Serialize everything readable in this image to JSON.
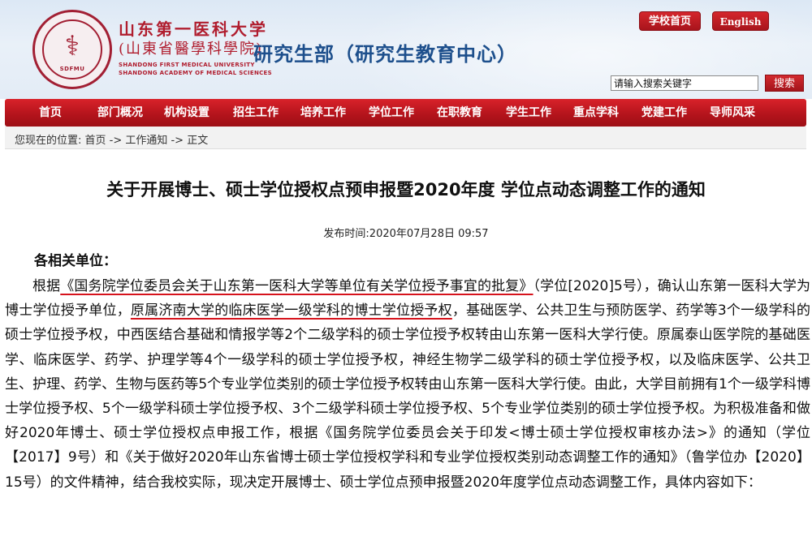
{
  "header": {
    "university_cn_line1": "山东第一医科大学",
    "university_cn_line2": "(山東省醫學科學院)",
    "university_en_line1": "SHANDONG FIRST MEDICAL UNIVERSITY",
    "university_en_line2": "SHANDONG ACADEMY OF MEDICAL SCIENCES",
    "logo_text": "SDFMU",
    "department": "研究生部（研究生教育中心）",
    "home_button": "学校首页",
    "english_button": "English",
    "search_placeholder": "请输入搜索关键字",
    "search_button": "搜索"
  },
  "nav": {
    "items": [
      {
        "label": "首页"
      },
      {
        "label": "部门概况"
      },
      {
        "label": "机构设置"
      },
      {
        "label": "招生工作"
      },
      {
        "label": "培养工作"
      },
      {
        "label": "学位工作"
      },
      {
        "label": "在职教育"
      },
      {
        "label": "学生工作"
      },
      {
        "label": "重点学科"
      },
      {
        "label": "党建工作"
      },
      {
        "label": "导师风采"
      }
    ]
  },
  "breadcrumb": {
    "text": "您现在的位置: 首页 -> 工作通知 -> 正文"
  },
  "article": {
    "title": "关于开展博士、硕士学位授权点预申报暨2020年度 学位点动态调整工作的通知",
    "publish_time": "发布时间:2020年07月28日 09:57",
    "greeting": "各相关单位：",
    "p_lead": "根据",
    "p_link1": "《国务院学位委员会关于山东第一医科大学等单位有关学位授予事宜的批复》",
    "p_mid1": "（学位[2020]5号），确认山东第一医科大学为博士学位授予单位，",
    "p_link2": "原属济南大学的临床医学一级学科的博士学位授予权",
    "p_rest": "，基础医学、公共卫生与预防医学、药学等3个一级学科的硕士学位授予权，中西医结合基础和情报学等2个二级学科的硕士学位授予权转由山东第一医科大学行使。原属泰山医学院的基础医学、临床医学、药学、护理学等4个一级学科的硕士学位授予权，神经生物学二级学科的硕士学位授予权，以及临床医学、公共卫生、护理、药学、生物与医药等5个专业学位类别的硕士学位授予权转由山东第一医科大学行使。由此，大学目前拥有1个一级学科博士学位授予权、5个一级学科硕士学位授予权、3个二级学科硕士学位授予权、5个专业学位类别的硕士学位授予权。为积极准备和做好2020年博士、硕士学位授权点申报工作，根据《国务院学位委员会关于印发<博士硕士学位授权审核办法>》的通知（学位【2017】9号）和《关于做好2020年山东省博士硕士学位授权学科和专业学位授权类别动态调整工作的通知》（鲁学位办【2020】15号）的文件精神，结合我校实际，现决定开展博士、硕士学位点预申报暨2020年度学位点动态调整工作，具体内容如下："
  },
  "colors": {
    "brand_red": "#b5141c",
    "dept_blue": "#1d4f8c",
    "underline_red": "#d6131c"
  }
}
